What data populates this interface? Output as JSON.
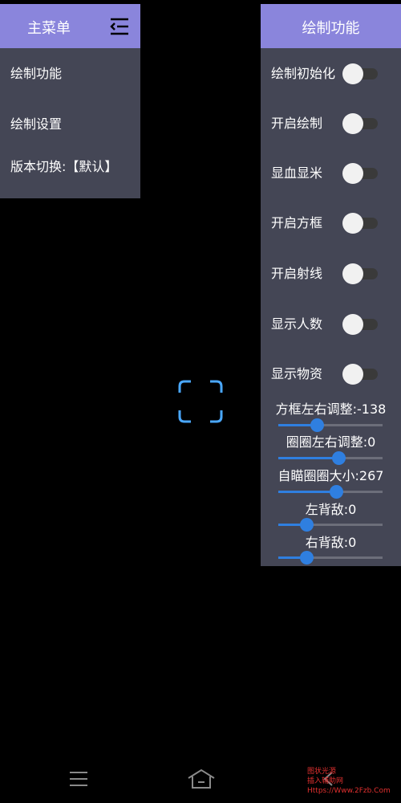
{
  "main_menu": {
    "title": "主菜单",
    "items": [
      {
        "label": "绘制功能"
      },
      {
        "label": "绘制设置"
      },
      {
        "label": "版本切换:【默认】"
      }
    ]
  },
  "draw_panel": {
    "title": "绘制功能",
    "toggles": [
      {
        "label": "绘制初始化",
        "on": false
      },
      {
        "label": "开启绘制",
        "on": false
      },
      {
        "label": "显血显米",
        "on": false
      },
      {
        "label": "开启方框",
        "on": false
      },
      {
        "label": "开启射线",
        "on": false
      },
      {
        "label": "显示人数",
        "on": false
      },
      {
        "label": "显示物资",
        "on": false
      }
    ],
    "sliders": [
      {
        "label": "方框左右调整:-138",
        "fraction": 0.37
      },
      {
        "label": "圈圈左右调整:0",
        "fraction": 0.58
      },
      {
        "label": "自瞄圈圈大小:267",
        "fraction": 0.55
      },
      {
        "label": "左背敌:0",
        "fraction": 0.27
      },
      {
        "label": "右背敌:0",
        "fraction": 0.27
      }
    ]
  },
  "watermark": {
    "line1": "图状光源",
    "line2": "插入辅助网",
    "line3": "Https://Www.2Fzb.Com"
  },
  "colors": {
    "header": "#8a85dc",
    "panel": "#444655",
    "accent": "#2f7fe0",
    "focus_icon": "#4aa8ff"
  }
}
